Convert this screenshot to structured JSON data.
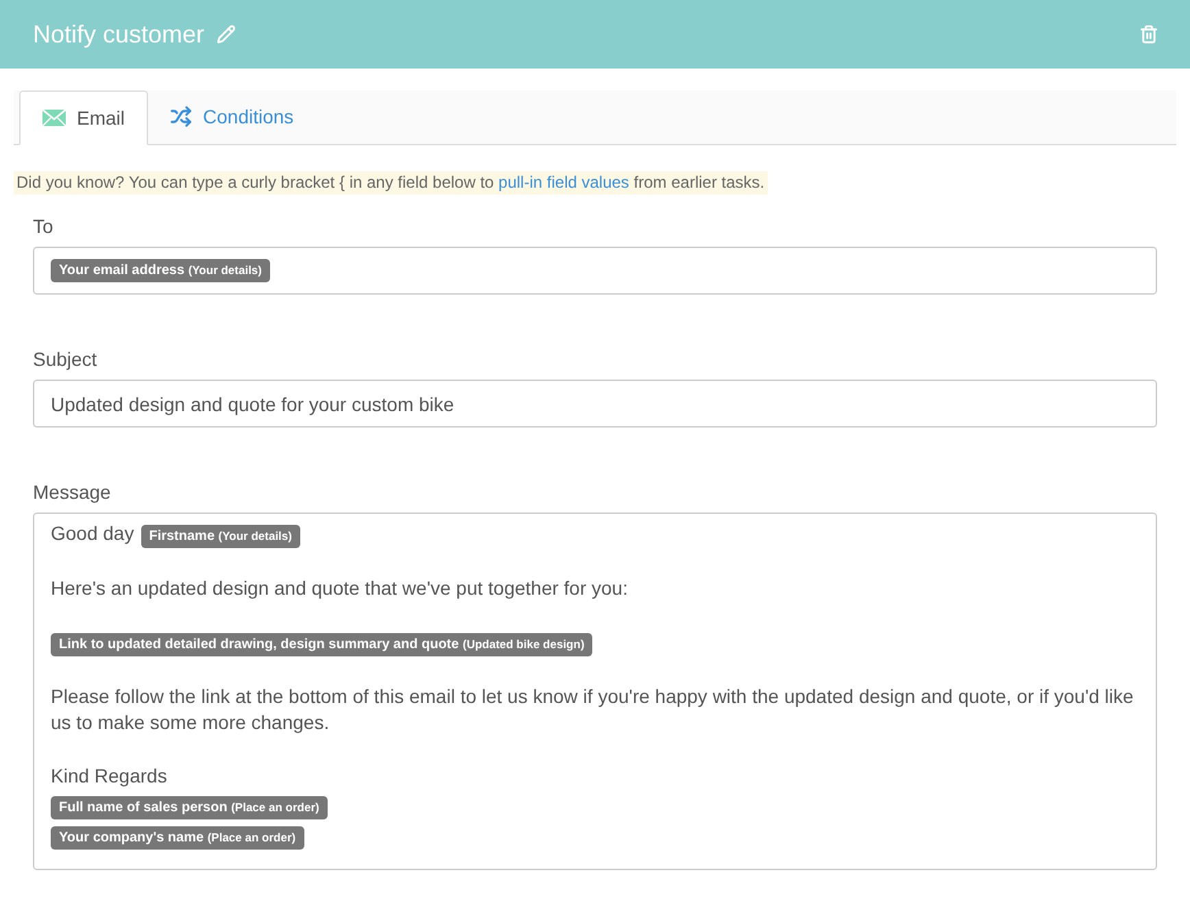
{
  "header": {
    "title": "Notify customer"
  },
  "tabs": [
    {
      "label": "Email",
      "kind": "email",
      "selected": true
    },
    {
      "label": "Conditions",
      "kind": "conditions",
      "selected": false
    }
  ],
  "hint": {
    "before": "Did you know? You can type a curly bracket { in any field below to ",
    "link": "pull-in field values",
    "after": " from earlier tasks."
  },
  "to": {
    "label": "To",
    "tags": [
      {
        "label": "Your email address",
        "source": "(Your details)"
      }
    ]
  },
  "subject": {
    "label": "Subject",
    "value": "Updated design and quote for your custom bike"
  },
  "message": {
    "label": "Message",
    "blocks": [
      {
        "kind": "line",
        "text": "Good day",
        "tag": {
          "label": "Firstname",
          "source": "(Your details)"
        }
      },
      {
        "kind": "paragraph",
        "text": "Here's an updated design and quote that we've put together for you:"
      },
      {
        "kind": "tag",
        "tag": {
          "label": "Link to updated detailed drawing, design summary and quote",
          "source": "(Updated bike design)"
        }
      },
      {
        "kind": "paragraph",
        "text": "Please follow the link at the bottom of this email to let us know if you're happy with the updated design and quote, or if you'd like us to make some more changes."
      },
      {
        "kind": "line",
        "text": "Kind Regards"
      },
      {
        "kind": "tag",
        "tag": {
          "label": "Full name of sales person",
          "source": "(Place an order)"
        }
      },
      {
        "kind": "tag",
        "tag": {
          "label": "Your company's name",
          "source": "(Place an order)"
        }
      }
    ]
  }
}
